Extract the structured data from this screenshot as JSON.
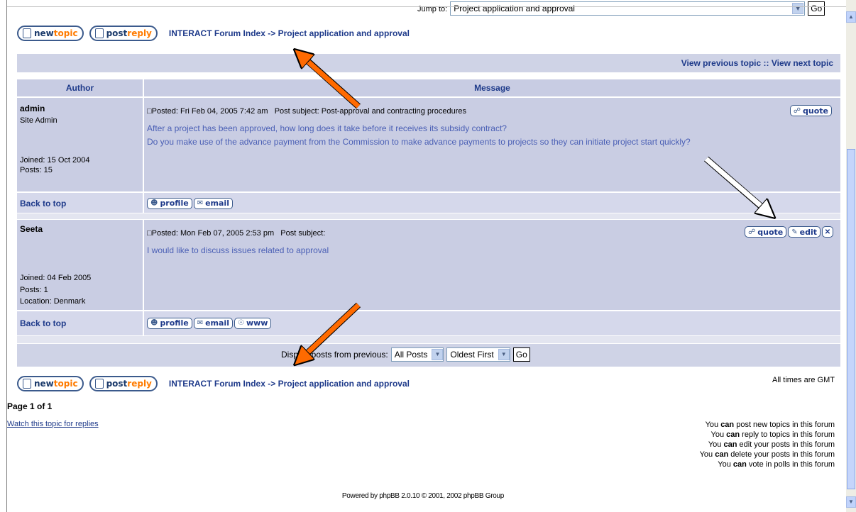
{
  "jump": {
    "label": "Jump to:",
    "value": "Project application and approval",
    "go": "Go"
  },
  "nav": {
    "new_topic": [
      "new",
      "topic"
    ],
    "post_reply": [
      "post",
      "reply"
    ],
    "forum_index": "INTERACT Forum Index",
    "sep": " -> ",
    "forum_name": "Project application and approval"
  },
  "topic_nav": {
    "prev": "View previous topic",
    "sep": " :: ",
    "next": "View next topic"
  },
  "table_headers": {
    "author": "Author",
    "message": "Message"
  },
  "posts": [
    {
      "author": "admin",
      "rank": "Site Admin",
      "joined": "Joined: 15 Oct 2004",
      "posts": "Posts: 15",
      "location": "",
      "posted": "Posted: Fri Feb 04, 2005 7:42 am",
      "subject_label": "Post subject:",
      "subject": "Post-approval and contracting procedures",
      "body_lines": [
        "After a project has been approved, how long does it take before it receives its subsidy contract?",
        "Do you make use of the advance payment from the Commission to make advance payments to projects so they can initiate project start quickly?"
      ],
      "buttons": [
        "quote"
      ],
      "footer_buttons": [
        "profile",
        "email"
      ]
    },
    {
      "author": "Seeta",
      "rank": "",
      "joined": "Joined: 04 Feb 2005",
      "posts": "Posts: 1",
      "location": "Location: Denmark",
      "posted": "Posted: Mon Feb 07, 2005 2:53 pm",
      "subject_label": "Post subject:",
      "subject": "",
      "body_lines": [
        "I would like to discuss issues related to approval"
      ],
      "buttons": [
        "quote",
        "edit"
      ],
      "footer_buttons": [
        "profile",
        "email",
        "www"
      ]
    }
  ],
  "back_to_top": "Back to top",
  "display": {
    "label": "Display posts from previous:",
    "range": "All Posts",
    "order": "Oldest First",
    "go": "Go"
  },
  "timezone": "All times are GMT",
  "page": "Page 1 of 1",
  "watch": "Watch this topic for replies",
  "permissions": [
    [
      "You ",
      "can",
      " post new topics in this forum"
    ],
    [
      "You ",
      "can",
      " reply to topics in this forum"
    ],
    [
      "You ",
      "can",
      " edit your posts in this forum"
    ],
    [
      "You ",
      "can",
      " delete your posts in this forum"
    ],
    [
      "You ",
      "can",
      " vote in polls in this forum"
    ]
  ],
  "footer": "Powered by phpBB 2.0.10 © 2001, 2002 phpBB Group",
  "colors": {
    "header_bar": "#c8cce3",
    "link": "#1e3a8a",
    "post_text": "#4a5fb5",
    "arrow": "#ff6a00"
  }
}
